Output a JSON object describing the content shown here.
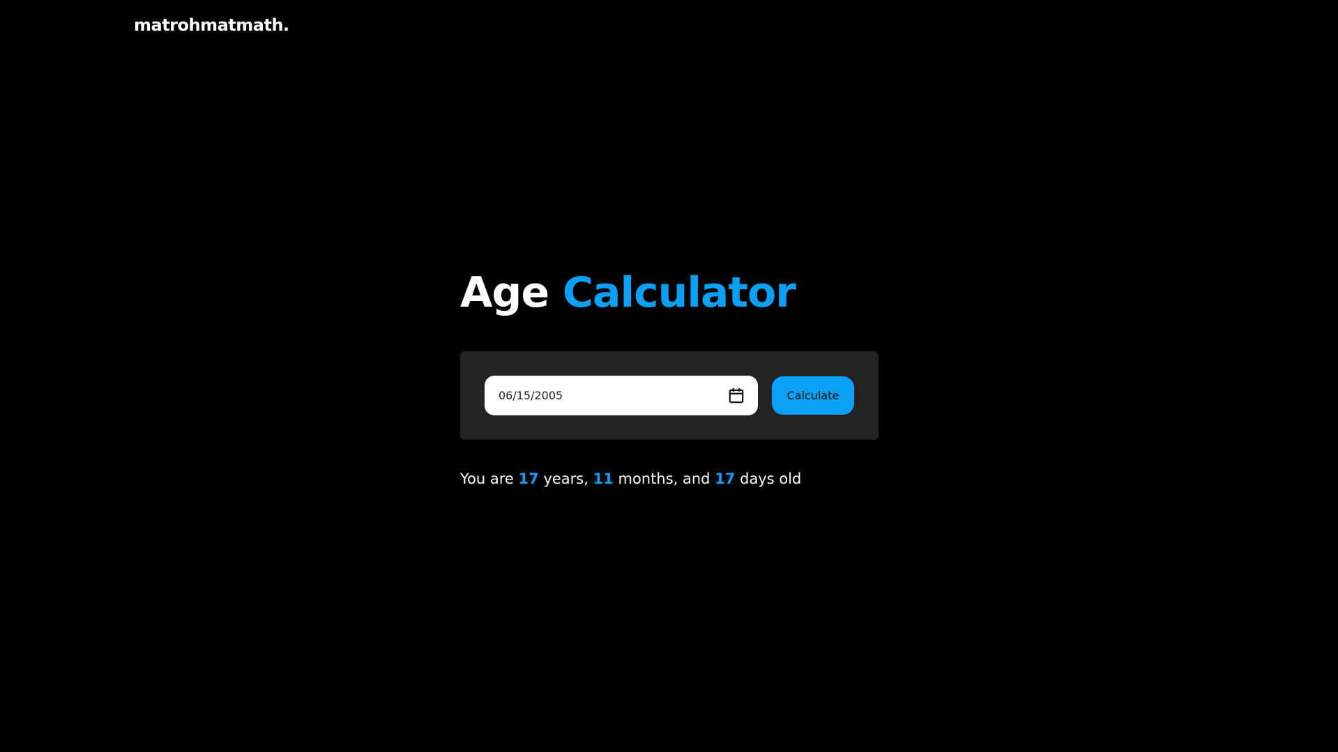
{
  "header": {
    "logo": "matrohmatmath."
  },
  "hero": {
    "title_word1": "Age",
    "title_word2": "Calculator"
  },
  "form": {
    "date_value": "06/15/2005",
    "calculate_label": "Calculate"
  },
  "result": {
    "prefix": "You are",
    "years": "17",
    "years_label": "years,",
    "months": "11",
    "months_label": "months, and",
    "days": "17",
    "days_label": "days old"
  },
  "colors": {
    "background": "#000000",
    "accent": "#0aa0f5",
    "card": "#232323",
    "text": "#ffffff"
  },
  "icons": {
    "date_picker": "calendar-icon"
  }
}
